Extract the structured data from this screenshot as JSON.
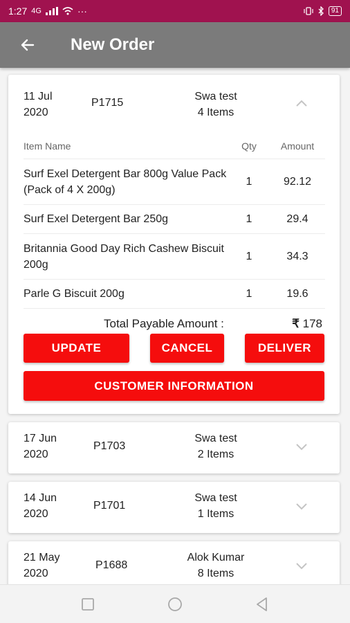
{
  "status_bar": {
    "time": "1:27",
    "network": "4G",
    "battery": "91"
  },
  "header": {
    "title": "New Order",
    "back_icon": "arrow-left-icon"
  },
  "currency_symbol": "₹",
  "colors": {
    "status_bar": "#a0124f",
    "app_bar": "#7b7b7b",
    "button": "#f50d0d"
  },
  "orders": [
    {
      "date_line1": "11 Jul",
      "date_line2": "2020",
      "order_id": "P1715",
      "customer": "Swa test",
      "items_count": "4 Items",
      "expanded": true,
      "items_header": {
        "name": "Item Name",
        "qty": "Qty",
        "amount": "Amount"
      },
      "items": [
        {
          "name": "Surf Exel Detergent Bar 800g Value Pack (Pack of 4 X 200g)",
          "qty": "1",
          "amount": "92.12"
        },
        {
          "name": "Surf Exel Detergent Bar 250g",
          "qty": "1",
          "amount": "29.4"
        },
        {
          "name": "Britannia Good Day Rich Cashew Biscuit 200g",
          "qty": "1",
          "amount": "34.3"
        },
        {
          "name": "Parle G Biscuit 200g",
          "qty": "1",
          "amount": "19.6"
        }
      ],
      "total_label": "Total Payable Amount :",
      "total_value": "178",
      "buttons": {
        "update": "UPDATE",
        "cancel": "CANCEL",
        "deliver": "DELIVER",
        "customer_info": "CUSTOMER INFORMATION"
      }
    },
    {
      "date_line1": "17 Jun",
      "date_line2": "2020",
      "order_id": "P1703",
      "customer": "Swa test",
      "items_count": "2 Items",
      "expanded": false
    },
    {
      "date_line1": "14 Jun",
      "date_line2": "2020",
      "order_id": "P1701",
      "customer": "Swa test",
      "items_count": "1 Items",
      "expanded": false
    },
    {
      "date_line1": "21 May",
      "date_line2": "2020",
      "order_id": "P1688",
      "customer": "Alok Kumar",
      "items_count": "8 Items",
      "expanded": false
    }
  ],
  "nav_bar": {
    "icons": [
      "recent-apps-icon",
      "home-icon",
      "back-nav-icon"
    ]
  }
}
